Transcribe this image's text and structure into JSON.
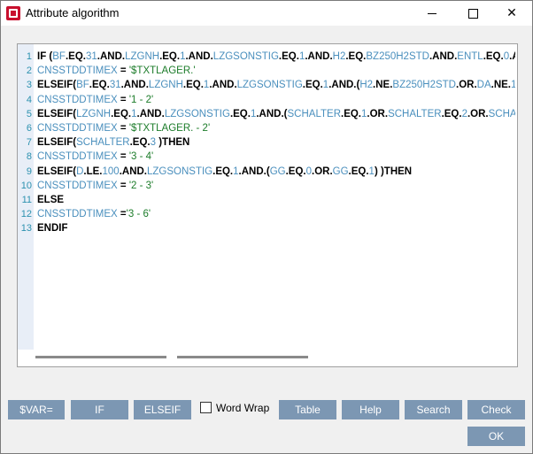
{
  "window": {
    "title": "Attribute algorithm",
    "minimize_icon": "minimize-icon",
    "maximize_icon": "maximize-icon",
    "close_icon": "close-icon",
    "close_glyph": "✕"
  },
  "editor": {
    "lines": [
      {
        "num": "1",
        "parts": [
          [
            "kw",
            "IF ("
          ],
          [
            "var",
            "BF"
          ],
          [
            "kw",
            ".EQ."
          ],
          [
            "var",
            "31"
          ],
          [
            "kw",
            ".AND."
          ],
          [
            "var",
            "LZGNH"
          ],
          [
            "kw",
            ".EQ."
          ],
          [
            "var",
            "1"
          ],
          [
            "kw",
            ".AND."
          ],
          [
            "var",
            "LZGSONSTIG"
          ],
          [
            "kw",
            ".EQ."
          ],
          [
            "var",
            "1"
          ],
          [
            "kw",
            ".AND."
          ],
          [
            "var",
            "H2"
          ],
          [
            "kw",
            ".EQ."
          ],
          [
            "var",
            "BZ250H2STD"
          ],
          [
            "kw",
            ".AND."
          ],
          [
            "var",
            "ENTL"
          ],
          [
            "kw",
            ".EQ."
          ],
          [
            "var",
            "0"
          ],
          [
            "kw",
            ".A"
          ]
        ]
      },
      {
        "num": "2",
        "parts": [
          [
            "var",
            " CNSSTDDTIMEX"
          ],
          [
            "kw",
            " = "
          ],
          [
            "str",
            "'$TXTLAGER.'"
          ]
        ]
      },
      {
        "num": "3",
        "parts": [
          [
            "kw",
            "ELSEIF("
          ],
          [
            "var",
            "BF"
          ],
          [
            "kw",
            ".EQ."
          ],
          [
            "var",
            "31"
          ],
          [
            "kw",
            ".AND."
          ],
          [
            "var",
            "LZGNH"
          ],
          [
            "kw",
            ".EQ."
          ],
          [
            "var",
            "1"
          ],
          [
            "kw",
            ".AND."
          ],
          [
            "var",
            "LZGSONSTIG"
          ],
          [
            "kw",
            ".EQ."
          ],
          [
            "var",
            "1"
          ],
          [
            "kw",
            ".AND.("
          ],
          [
            "var",
            "H2"
          ],
          [
            "kw",
            ".NE."
          ],
          [
            "var",
            "BZ250H2STD"
          ],
          [
            "kw",
            ".OR."
          ],
          [
            "var",
            "DA"
          ],
          [
            "kw",
            ".NE."
          ],
          [
            "var",
            "1"
          ],
          [
            "kw",
            "."
          ]
        ]
      },
      {
        "num": "4",
        "parts": [
          [
            "var",
            " CNSSTDDTIMEX"
          ],
          [
            "kw",
            " = "
          ],
          [
            "str",
            "'1 - 2'"
          ]
        ]
      },
      {
        "num": "5",
        "parts": [
          [
            "kw",
            "ELSEIF("
          ],
          [
            "var",
            "LZGNH"
          ],
          [
            "kw",
            ".EQ."
          ],
          [
            "var",
            "1"
          ],
          [
            "kw",
            ".AND."
          ],
          [
            "var",
            "LZGSONSTIG"
          ],
          [
            "kw",
            ".EQ."
          ],
          [
            "var",
            "1"
          ],
          [
            "kw",
            ".AND.("
          ],
          [
            "var",
            "SCHALTER"
          ],
          [
            "kw",
            ".EQ."
          ],
          [
            "var",
            "1"
          ],
          [
            "kw",
            ".OR."
          ],
          [
            "var",
            "SCHALTER"
          ],
          [
            "kw",
            ".EQ."
          ],
          [
            "var",
            "2"
          ],
          [
            "kw",
            ".OR."
          ],
          [
            "var",
            "SCHALTI"
          ]
        ]
      },
      {
        "num": "6",
        "parts": [
          [
            "var",
            " CNSSTDDTIMEX"
          ],
          [
            "kw",
            " = "
          ],
          [
            "str",
            "'$TXTLAGER. - 2'"
          ]
        ]
      },
      {
        "num": "7",
        "parts": [
          [
            "kw",
            "ELSEIF("
          ],
          [
            "var",
            "SCHALTER"
          ],
          [
            "kw",
            ".EQ."
          ],
          [
            "var",
            "3"
          ],
          [
            "kw",
            " )THEN"
          ]
        ]
      },
      {
        "num": "8",
        "parts": [
          [
            "var",
            " CNSSTDDTIMEX"
          ],
          [
            "kw",
            " = "
          ],
          [
            "str",
            "'3 - 4'"
          ]
        ]
      },
      {
        "num": "9",
        "parts": [
          [
            "kw",
            "ELSEIF("
          ],
          [
            "var",
            "D"
          ],
          [
            "kw",
            ".LE."
          ],
          [
            "var",
            "100"
          ],
          [
            "kw",
            ".AND."
          ],
          [
            "var",
            "LZGSONSTIG"
          ],
          [
            "kw",
            ".EQ."
          ],
          [
            "var",
            "1"
          ],
          [
            "kw",
            ".AND.("
          ],
          [
            "var",
            "GG"
          ],
          [
            "kw",
            ".EQ."
          ],
          [
            "var",
            "0"
          ],
          [
            "kw",
            ".OR."
          ],
          [
            "var",
            "GG"
          ],
          [
            "kw",
            ".EQ."
          ],
          [
            "var",
            "1"
          ],
          [
            "kw",
            ") )THEN"
          ]
        ]
      },
      {
        "num": "10",
        "parts": [
          [
            "var",
            " CNSSTDDTIMEX"
          ],
          [
            "kw",
            " = "
          ],
          [
            "str",
            "'2 - 3'"
          ]
        ]
      },
      {
        "num": "11",
        "parts": [
          [
            "kw",
            "ELSE"
          ]
        ]
      },
      {
        "num": "12",
        "parts": [
          [
            "var",
            " CNSSTDDTIMEX"
          ],
          [
            "kw",
            " ="
          ],
          [
            "str",
            "'3 - 6'"
          ]
        ]
      },
      {
        "num": "13",
        "parts": [
          [
            "kw",
            "ENDIF"
          ]
        ]
      }
    ]
  },
  "buttons": {
    "var": "$VAR=",
    "if": "IF",
    "elseif": "ELSEIF",
    "table": "Table",
    "help": "Help",
    "search": "Search",
    "check": "Check",
    "ok": "OK"
  },
  "word_wrap": {
    "label": "Word Wrap",
    "checked": false
  },
  "colors": {
    "keyword": "#000000",
    "variable": "#4a8fbd",
    "string": "#1c7c2a",
    "button": "#7c97b3"
  }
}
